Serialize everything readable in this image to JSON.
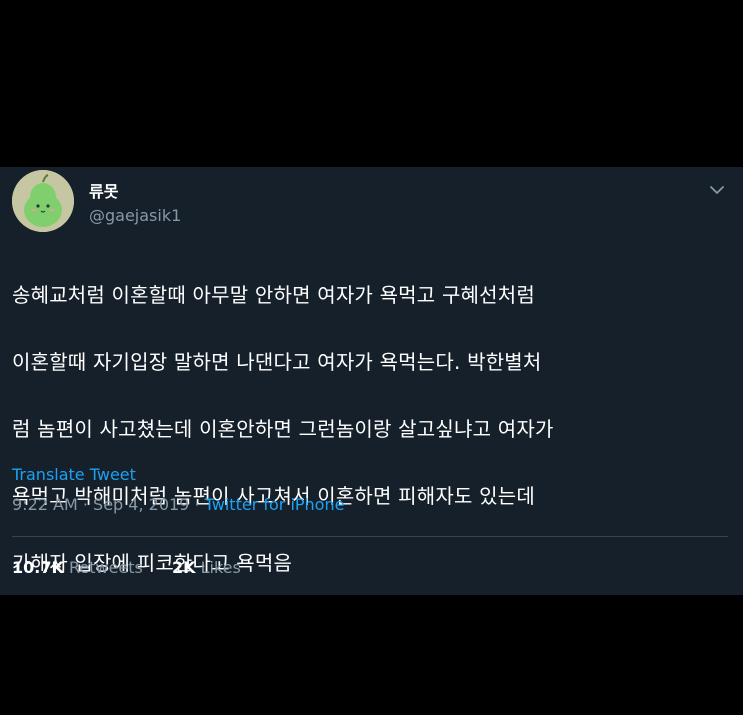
{
  "tweet": {
    "author": {
      "display_name": "류못",
      "handle": "@gaejasik1",
      "avatar_icon": "pear-character-avatar"
    },
    "menu_icon": "chevron-down-icon",
    "text_lines": [
      "송혜교처럼 이혼할때 아무말 안하면 여자가 욕먹고 구혜선처럼",
      "이혼할때 자기입장 말하면 나댄다고 여자가 욕먹는다. 박한별처",
      "럼 놈편이 사고쳤는데 이혼안하면 그런놈이랑 살고싶냐고 여자가",
      "욕먹고 박해미처럼 놈편이 사고쳐서 이혼하면 피해자도 있는데",
      "가해자 입장에 피코한다고 욕먹음"
    ],
    "translate_label": "Translate Tweet",
    "time": "9:22 AM",
    "separator": "·",
    "date": "Sep 4, 2019",
    "source": "Twitter for iPhone",
    "retweets_count": "10.7K",
    "retweets_label": "Retweets",
    "likes_count": "2K",
    "likes_label": "Likes"
  },
  "colors": {
    "background": "#000000",
    "card": "#15202b",
    "link": "#1da1f2",
    "secondary_text": "#8899a6",
    "divider": "#38444d"
  }
}
